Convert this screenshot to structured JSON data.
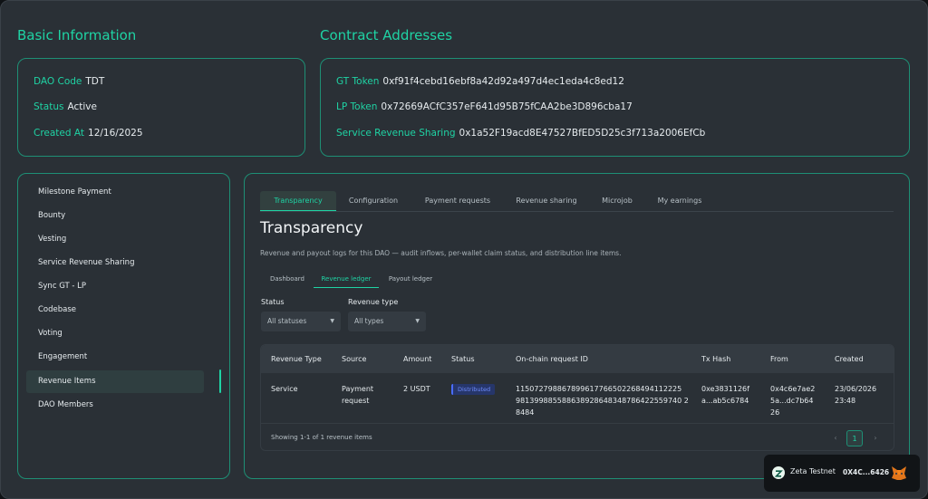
{
  "basic_info": {
    "title": "Basic Information",
    "rows": [
      {
        "key": "DAO Code",
        "value": "TDT"
      },
      {
        "key": "Status",
        "value": "Active"
      },
      {
        "key": "Created At",
        "value": "12/16/2025"
      }
    ]
  },
  "contracts": {
    "title": "Contract Addresses",
    "rows": [
      {
        "key": "GT Token",
        "value": "0xf91f4cebd16ebf8a42d92a497d4ec1eda4c8ed12"
      },
      {
        "key": "LP Token",
        "value": "0x72669ACfC357eF641d95B75fCAA2be3D896cba17"
      },
      {
        "key": "Service Revenue Sharing",
        "value": "0x1a52F19acd8E47527BfED5D25c3f713a2006EfCb"
      }
    ]
  },
  "sidebar": {
    "items": [
      {
        "label": "Milestone Payment"
      },
      {
        "label": "Bounty"
      },
      {
        "label": "Vesting"
      },
      {
        "label": "Service Revenue Sharing"
      },
      {
        "label": "Sync GT - LP"
      },
      {
        "label": "Codebase"
      },
      {
        "label": "Voting"
      },
      {
        "label": "Engagement"
      },
      {
        "label": "Revenue Items",
        "active": true
      },
      {
        "label": "DAO Members"
      }
    ]
  },
  "main": {
    "tabs": [
      {
        "label": "Transparency",
        "active": true
      },
      {
        "label": "Configuration"
      },
      {
        "label": "Payment requests"
      },
      {
        "label": "Revenue sharing"
      },
      {
        "label": "Microjob"
      },
      {
        "label": "My earnings"
      }
    ],
    "heading": "Transparency",
    "description": "Revenue and payout logs for this DAO — audit inflows, per-wallet claim status, and distribution line items.",
    "subtabs": [
      {
        "label": "Dashboard"
      },
      {
        "label": "Revenue ledger",
        "active": true
      },
      {
        "label": "Payout ledger"
      }
    ],
    "filters": {
      "status_label": "Status",
      "status_value": "All statuses",
      "type_label": "Revenue type",
      "type_value": "All types"
    },
    "table": {
      "columns": [
        "Revenue Type",
        "Source",
        "Amount",
        "Status",
        "On-chain request ID",
        "Tx Hash",
        "From",
        "Created"
      ],
      "rows": [
        {
          "revenue_type": "Service",
          "source_1": "Payment",
          "source_2": "request",
          "amount": "2 USDT",
          "status": "Distributed",
          "request_id_1": "115072798867899617766502268494112225",
          "request_id_2": "981399885588638928648348786422559740 2",
          "request_id_3": "8484",
          "tx_hash_1": "0xe3831126f",
          "tx_hash_2": "a...ab5c6784",
          "from_1": "0x4c6e7ae2",
          "from_2": "5a...dc7b64",
          "from_3": "26",
          "created_1": "23/06/2026",
          "created_2": "23:48"
        }
      ],
      "footer": "Showing 1-1 of 1 revenue items",
      "pagination": {
        "prev": "‹",
        "page": "1",
        "next": "›"
      }
    }
  },
  "wallet": {
    "network": "Zeta Testnet",
    "address": "0X4C...6426",
    "network_icon": "zeta-logo-icon",
    "wallet_icon": "metamask-fox-icon"
  },
  "colors": {
    "accent": "#1fd3a4",
    "background": "#2a3036",
    "card_border": "#1e8f75",
    "badge_blue": "#4a6cff"
  }
}
